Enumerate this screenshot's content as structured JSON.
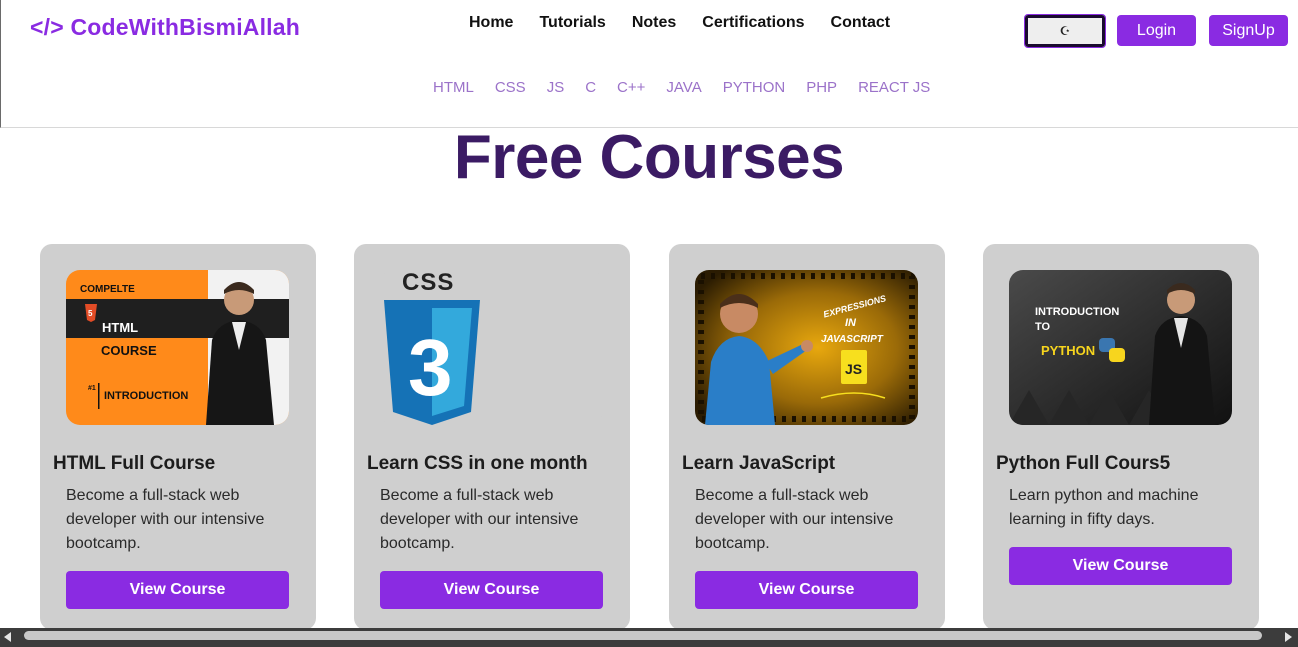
{
  "header": {
    "logo": "</> CodeWithBismiAllah",
    "nav": [
      "Home",
      "Tutorials",
      "Notes",
      "Certifications",
      "Contact"
    ],
    "languages": [
      "HTML",
      "CSS",
      "JS",
      "C",
      "C++",
      "JAVA",
      "PYTHON",
      "PHP",
      "REACT JS"
    ],
    "theme_icon": "☪",
    "login_label": "Login",
    "signup_label": "SignUp"
  },
  "page_title": "Free Courses",
  "courses": [
    {
      "title": "HTML Full Course",
      "description": "Become a full-stack web developer with our intensive bootcamp.",
      "button": "View Course",
      "thumb": {
        "line1": "COMPELTE",
        "line2": "HTML",
        "line3": "COURSE",
        "line4": "#1",
        "line5": "INTRODUCTION",
        "badge": "5"
      }
    },
    {
      "title": "Learn CSS in one month",
      "description": "Become a full-stack web developer with our intensive bootcamp.",
      "button": "View Course",
      "thumb": {
        "label": "CSS",
        "digit": "3"
      }
    },
    {
      "title": "Learn JavaScript",
      "description": "Become a full-stack web developer with our intensive bootcamp.",
      "button": "View Course",
      "thumb": {
        "line1": "EXPRESSIONS",
        "line2": "IN",
        "line3": "JAVASCRIPT",
        "badge": "JS"
      }
    },
    {
      "title": "Python Full Cours5",
      "description": "Learn python and machine learning in fifty days.",
      "button": "View Course",
      "thumb": {
        "line1": "INTRODUCTION",
        "line2": "TO",
        "line3": "PYTHON"
      }
    }
  ],
  "colors": {
    "accent": "#8a2be2",
    "heading": "#3b1b64",
    "card_bg": "#cfcfcf",
    "lang_link": "#9b72c9"
  }
}
